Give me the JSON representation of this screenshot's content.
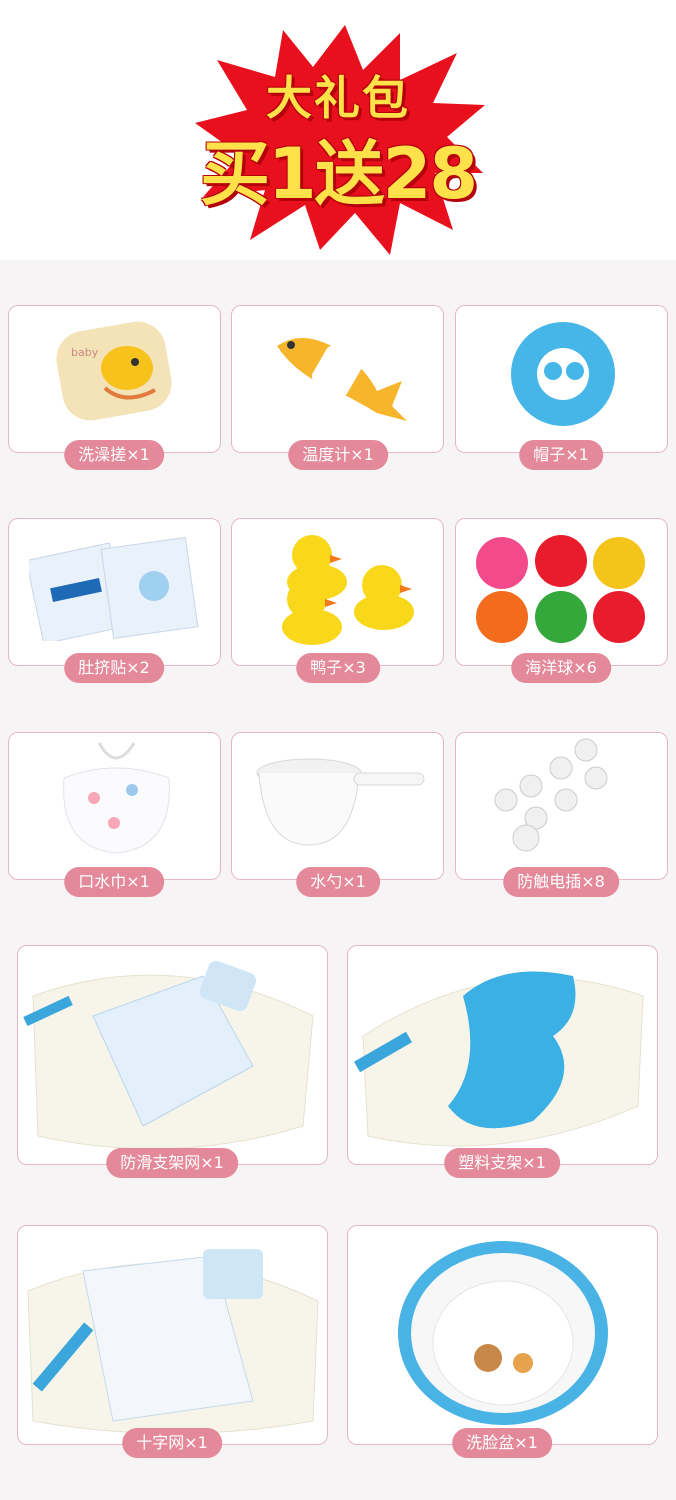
{
  "banner": {
    "line1": "大礼包",
    "line2": "买1送28"
  },
  "items": [
    {
      "label": "洗澡搓×1",
      "icon": "bath-sponge-icon"
    },
    {
      "label": "温度计×1",
      "icon": "fish-thermometer-icon"
    },
    {
      "label": "帽子×1",
      "icon": "shower-cap-icon"
    },
    {
      "label": "肚挤贴×2",
      "icon": "navel-patch-icon"
    },
    {
      "label": "鸭子×3",
      "icon": "rubber-duck-icon"
    },
    {
      "label": "海洋球×6",
      "icon": "ocean-balls-icon"
    },
    {
      "label": "口水巾×1",
      "icon": "bib-icon"
    },
    {
      "label": "水勺×1",
      "icon": "water-scoop-icon"
    },
    {
      "label": "防触电插×8",
      "icon": "outlet-cover-icon"
    },
    {
      "label": "防滑支架网×1",
      "icon": "tub-mesh-net-icon"
    },
    {
      "label": "塑料支架×1",
      "icon": "plastic-bath-support-icon"
    },
    {
      "label": "十字网×1",
      "icon": "cross-net-icon"
    },
    {
      "label": "洗脸盆×1",
      "icon": "wash-basin-icon"
    }
  ],
  "colors": {
    "tag": "#e3899a",
    "border": "#e7b8c1",
    "burst": "#e8101c"
  }
}
